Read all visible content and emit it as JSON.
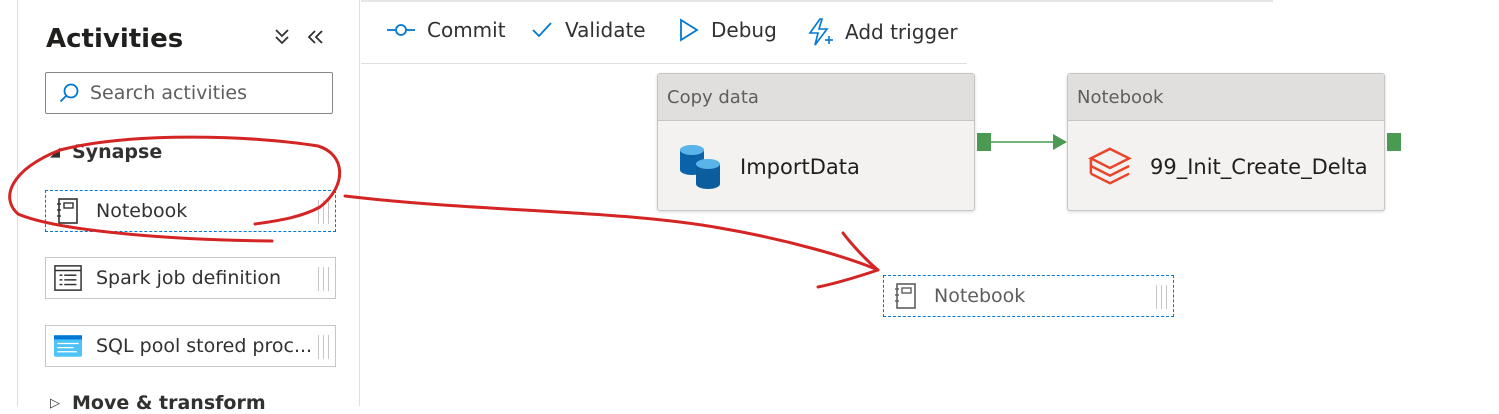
{
  "panel": {
    "title": "Activities",
    "search": {
      "placeholder": "Search activities",
      "value": ""
    },
    "groups": [
      {
        "label": "Synapse",
        "expanded": true
      },
      {
        "label": "Move & transform",
        "expanded": false
      }
    ],
    "items": [
      {
        "label": "Notebook",
        "icon": "notebook-icon",
        "selected": true
      },
      {
        "label": "Spark job definition",
        "icon": "spark-job-icon"
      },
      {
        "label": "SQL pool stored proc...",
        "icon": "sql-pool-icon"
      }
    ]
  },
  "toolbar": {
    "commit": "Commit",
    "validate": "Validate",
    "debug": "Debug",
    "add_trigger": "Add trigger"
  },
  "canvas": {
    "nodes": [
      {
        "type": "Copy data",
        "name": "ImportData",
        "icon": "copy-data-icon"
      },
      {
        "type": "Notebook",
        "name": "99_Init_Create_Delta",
        "icon": "databricks-icon"
      }
    ],
    "ghost": {
      "label": "Notebook",
      "icon": "notebook-icon"
    }
  },
  "colors": {
    "accent": "#0078d4",
    "success_port": "#4a9a52",
    "annotation": "#d42424",
    "databricks": "#e8452b"
  }
}
